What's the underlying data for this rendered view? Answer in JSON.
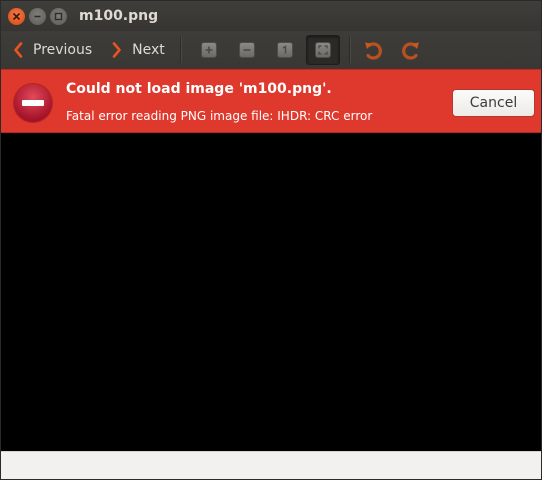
{
  "window": {
    "title": "m100.png"
  },
  "toolbar": {
    "previous_label": "Previous",
    "next_label": "Next",
    "icons": [
      "zoom-in-icon",
      "zoom-out-icon",
      "normal-size-icon",
      "best-fit-icon",
      "rotate-left-icon",
      "rotate-right-icon"
    ],
    "accent_color": "#e95420"
  },
  "infobar": {
    "title": "Could not load image 'm100.png'.",
    "message": "Fatal error reading PNG image file: IHDR: CRC error",
    "cancel_label": "Cancel",
    "background_color": "#df382c"
  },
  "statusbar": {
    "text": ""
  }
}
